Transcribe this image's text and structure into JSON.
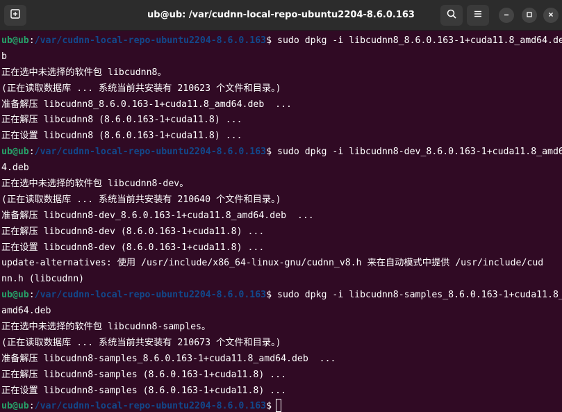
{
  "window": {
    "title": "ub@ub: /var/cudnn-local-repo-ubuntu2204-8.6.0.163"
  },
  "icons": {
    "new_tab": "new-tab-icon",
    "search": "search-icon",
    "menu": "hamburger-menu-icon",
    "minimize": "minimize-icon",
    "maximize": "maximize-icon",
    "close": "close-icon"
  },
  "colors": {
    "background": "#300a24",
    "user": "#26a269",
    "path": "#12488b",
    "text": "#ffffff"
  },
  "prompt": {
    "user": "ub@ub",
    "separator": ":",
    "path": "/var/cudnn-local-repo-ubuntu2204-8.6.0.163",
    "symbol": "$"
  },
  "lines": [
    {
      "type": "prompt",
      "cmd": " sudo dpkg -i libcudnn8_8.6.0.163-1+cuda11.8_amd64.de"
    },
    {
      "type": "text",
      "text": "b"
    },
    {
      "type": "text",
      "text": "正在选中未选择的软件包 libcudnn8。"
    },
    {
      "type": "text",
      "text": "(正在读取数据库 ... 系统当前共安装有 210623 个文件和目录。)"
    },
    {
      "type": "text",
      "text": "准备解压 libcudnn8_8.6.0.163-1+cuda11.8_amd64.deb  ..."
    },
    {
      "type": "text",
      "text": "正在解压 libcudnn8 (8.6.0.163-1+cuda11.8) ..."
    },
    {
      "type": "text",
      "text": "正在设置 libcudnn8 (8.6.0.163-1+cuda11.8) ..."
    },
    {
      "type": "prompt",
      "cmd": " sudo dpkg -i libcudnn8-dev_8.6.0.163-1+cuda11.8_amd6"
    },
    {
      "type": "text",
      "text": "4.deb"
    },
    {
      "type": "text",
      "text": "正在选中未选择的软件包 libcudnn8-dev。"
    },
    {
      "type": "text",
      "text": "(正在读取数据库 ... 系统当前共安装有 210640 个文件和目录。)"
    },
    {
      "type": "text",
      "text": "准备解压 libcudnn8-dev_8.6.0.163-1+cuda11.8_amd64.deb  ..."
    },
    {
      "type": "text",
      "text": "正在解压 libcudnn8-dev (8.6.0.163-1+cuda11.8) ..."
    },
    {
      "type": "text",
      "text": "正在设置 libcudnn8-dev (8.6.0.163-1+cuda11.8) ..."
    },
    {
      "type": "text",
      "text": "update-alternatives: 使用 /usr/include/x86_64-linux-gnu/cudnn_v8.h 来在自动模式中提供 /usr/include/cud"
    },
    {
      "type": "text",
      "text": "nn.h (libcudnn)"
    },
    {
      "type": "prompt",
      "cmd": " sudo dpkg -i libcudnn8-samples_8.6.0.163-1+cuda11.8_"
    },
    {
      "type": "text",
      "text": "amd64.deb"
    },
    {
      "type": "text",
      "text": "正在选中未选择的软件包 libcudnn8-samples。"
    },
    {
      "type": "text",
      "text": "(正在读取数据库 ... 系统当前共安装有 210673 个文件和目录。)"
    },
    {
      "type": "text",
      "text": "准备解压 libcudnn8-samples_8.6.0.163-1+cuda11.8_amd64.deb  ..."
    },
    {
      "type": "text",
      "text": "正在解压 libcudnn8-samples (8.6.0.163-1+cuda11.8) ..."
    },
    {
      "type": "text",
      "text": "正在设置 libcudnn8-samples (8.6.0.163-1+cuda11.8) ..."
    },
    {
      "type": "prompt",
      "cmd": "",
      "cursor": true
    }
  ]
}
